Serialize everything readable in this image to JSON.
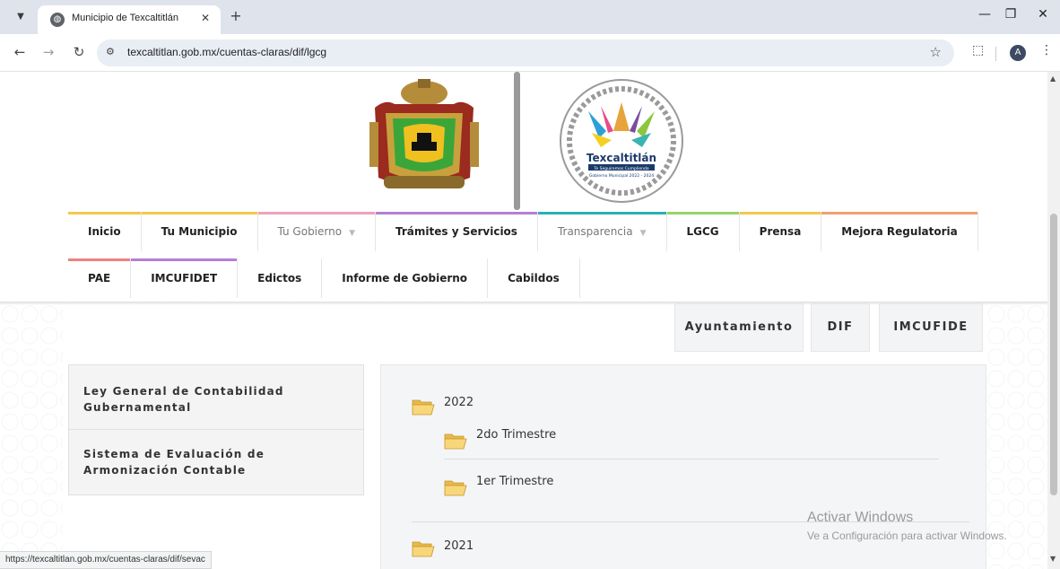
{
  "browser": {
    "tab_title": "Municipio de Texcaltitlán",
    "url": "texcaltitlan.gob.mx/cuentas-claras/dif/lgcg",
    "avatar_letter": "A"
  },
  "header": {
    "left_logo_icon": "municipal-coat-of-arms",
    "right_logo": {
      "title": "Texcaltitlán",
      "subtitle": "Te Seguiremos Cumpliendo",
      "caption": "Gobierno Municipal 2022 - 2024"
    }
  },
  "nav": {
    "row1": [
      {
        "label": "Inicio",
        "bar_color": "#f2c94c",
        "light": false
      },
      {
        "label": "Tu Municipio",
        "bar_color": "#f2c94c",
        "light": false
      },
      {
        "label": "Tu Gobierno",
        "bar_color": "#f2a0b8",
        "light": true,
        "caret": "▼"
      },
      {
        "label": "Trámites y Servicios",
        "bar_color": "#b37fd8",
        "light": false
      },
      {
        "label": "Transparencia",
        "bar_color": "#26b3b3",
        "light": true,
        "caret": "▼"
      },
      {
        "label": "LGCG",
        "bar_color": "#9bd16b",
        "light": false
      },
      {
        "label": "Prensa",
        "bar_color": "#f2c94c",
        "light": false
      },
      {
        "label": "Mejora Regulatoria",
        "bar_color": "#f0a070",
        "light": false
      }
    ],
    "row2": [
      {
        "label": "PAE",
        "bar_color": "#f08080"
      },
      {
        "label": "IMCUFIDET",
        "bar_color": "#b37fd8"
      },
      {
        "label": "Edictos",
        "bar_color": ""
      },
      {
        "label": "Informe de Gobierno",
        "bar_color": ""
      },
      {
        "label": "Cabildos",
        "bar_color": ""
      }
    ]
  },
  "subtabs": [
    "Ayuntamiento",
    "DIF",
    "IMCUFIDE"
  ],
  "sidebar": {
    "items": [
      "Ley General de Contabilidad Gubernamental",
      "Sistema de Evaluación de Armonización Contable"
    ]
  },
  "content": {
    "years": [
      {
        "label": "2022",
        "children": [
          "2do Trimestre",
          "1er Trimestre"
        ]
      },
      {
        "label": "2021",
        "children": []
      }
    ]
  },
  "watermark": {
    "line1": "Activar Windows",
    "line2": "Ve a Configuración para activar Windows."
  },
  "status_url": "https://texcaltitlan.gob.mx/cuentas-claras/dif/sevac"
}
